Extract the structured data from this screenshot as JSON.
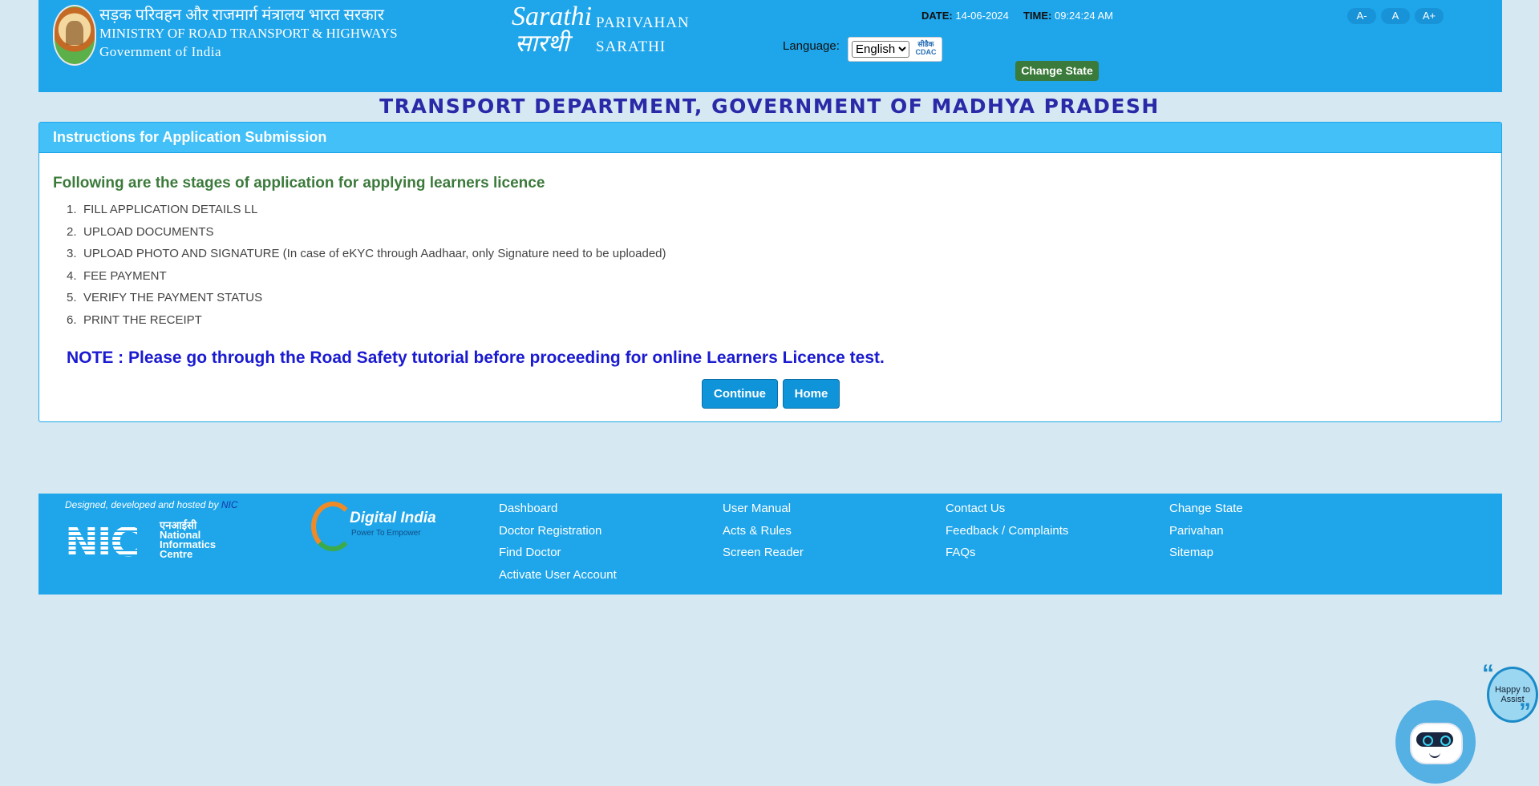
{
  "header": {
    "ministry_hindi": "सड़क परिवहन और राजमार्ग मंत्रालय भारत सरकार",
    "ministry_english": "MINISTRY OF ROAD TRANSPORT & HIGHWAYS",
    "government": "Government of India",
    "logo_sarathi_top": "Sarathi",
    "logo_sarathi_hindi": "सारथी",
    "parivahan": "PARIVAHAN",
    "sarathi": "SARATHI",
    "date_label": "DATE:",
    "date_value": "14-06-2024",
    "time_label": "TIME:",
    "time_value": "09:24:24 AM",
    "language_label": "Language:",
    "language_selected": "English",
    "cdac_label": "सीडैक CDAC",
    "change_state": "Change State",
    "font_decrease": "A-",
    "font_normal": "A",
    "font_increase": "A+"
  },
  "department_title": "TRANSPORT DEPARTMENT, GOVERNMENT OF MADHYA PRADESH",
  "panel": {
    "title": "Instructions for Application Submission",
    "heading": "Following are the stages of application for applying learners licence",
    "stages": [
      {
        "num": "1.",
        "text": "FILL APPLICATION DETAILS LL"
      },
      {
        "num": "2.",
        "text": "UPLOAD DOCUMENTS"
      },
      {
        "num": "3.",
        "text": "UPLOAD PHOTO AND SIGNATURE (In case of eKYC through Aadhaar, only Signature need to be uploaded)"
      },
      {
        "num": "4.",
        "text": "FEE PAYMENT"
      },
      {
        "num": "5.",
        "text": "VERIFY THE PAYMENT STATUS"
      },
      {
        "num": "6.",
        "text": "PRINT THE RECEIPT"
      }
    ],
    "note": "NOTE : Please go through the Road Safety tutorial before proceeding for online Learners Licence test.",
    "continue_label": "Continue",
    "home_label": "Home"
  },
  "footer": {
    "credit_text": "Designed, developed and hosted by",
    "credit_link": "NIC",
    "nic_hindi": "एनआईसी",
    "nic_line1": "National",
    "nic_line2": "Informatics",
    "nic_line3": "Centre",
    "digital_india": "Digital India",
    "digital_india_tagline": "Power To Empower",
    "col1": [
      "Dashboard",
      "Doctor Registration",
      "Find Doctor",
      "Activate User Account"
    ],
    "col2": [
      "User Manual",
      "Acts & Rules",
      "Screen Reader"
    ],
    "col3": [
      "Contact Us",
      "Feedback / Complaints",
      "FAQs"
    ],
    "col4": [
      "Change State",
      "Parivahan",
      "Sitemap"
    ]
  },
  "chatbot": {
    "bubble_text": "Happy to Assist"
  },
  "colors": {
    "header_bg": "#1ea5ea",
    "page_bg": "#d6e9f3",
    "panel_head_bg": "#42c0f7",
    "title_blue": "#2a2aa8",
    "heading_green": "#3c7a3c",
    "note_blue": "#1a1ad0",
    "button_blue": "#0f94da",
    "change_state_green": "#3a7a3a"
  }
}
